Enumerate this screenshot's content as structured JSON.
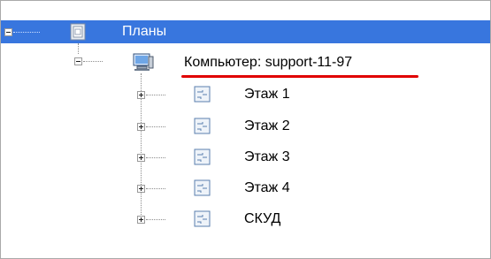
{
  "tree": {
    "root": {
      "label": "Планы",
      "icon": "plans-folder-icon",
      "expanded": true
    },
    "computer": {
      "label": "Компьютер: support-11-97",
      "icon": "computer-icon",
      "expanded": true,
      "highlight_color": "#e00000"
    },
    "floors": [
      {
        "label": "Этаж 1",
        "icon": "floor-plan-icon",
        "expanded": false
      },
      {
        "label": "Этаж 2",
        "icon": "floor-plan-icon",
        "expanded": false
      },
      {
        "label": "Этаж 3",
        "icon": "floor-plan-icon",
        "expanded": false
      },
      {
        "label": "Этаж 4",
        "icon": "floor-plan-icon",
        "expanded": false
      },
      {
        "label": "СКУД",
        "icon": "floor-plan-icon",
        "expanded": false
      }
    ]
  },
  "colors": {
    "selection": "#3876de",
    "accent_underline": "#e00000"
  }
}
